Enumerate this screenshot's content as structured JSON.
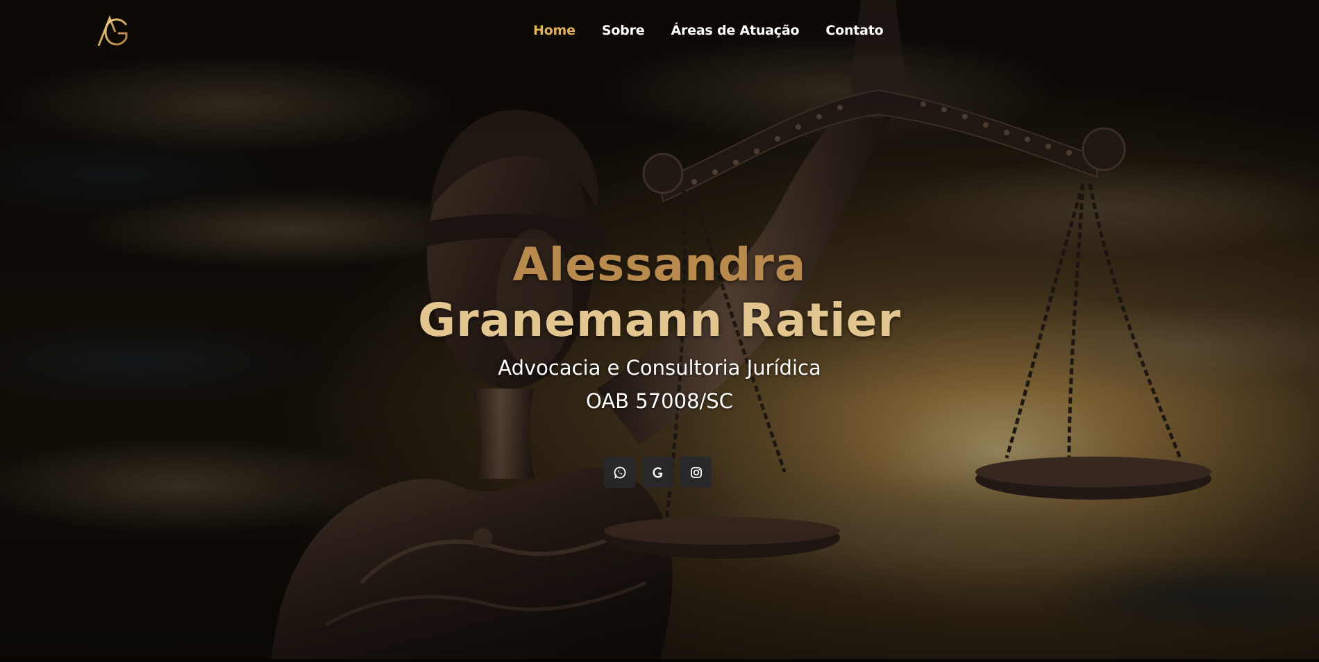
{
  "nav": {
    "logo_icon": "ag-monogram-logo-icon",
    "items": [
      {
        "label": "Home",
        "active": true
      },
      {
        "label": "Sobre",
        "active": false
      },
      {
        "label": "Áreas de Atuação",
        "active": false
      },
      {
        "label": "Contato",
        "active": false
      }
    ],
    "active_color": "#e2b05b"
  },
  "hero": {
    "title_line1": "Alessandra",
    "title_line2": "Granemann Ratier",
    "subtitle": "Advocacia e Consultoria Jurídica",
    "registration": "OAB 57008/SC",
    "background": "lady-justice-statue-with-scales-at-sunset"
  },
  "socials": [
    {
      "icon": "whatsapp-icon"
    },
    {
      "icon": "google-icon"
    },
    {
      "icon": "instagram-icon"
    }
  ],
  "colors": {
    "title_dark_gold": "#b88a4e",
    "title_light_gold": "#e3c58f",
    "social_button_bg": "#28282c"
  }
}
